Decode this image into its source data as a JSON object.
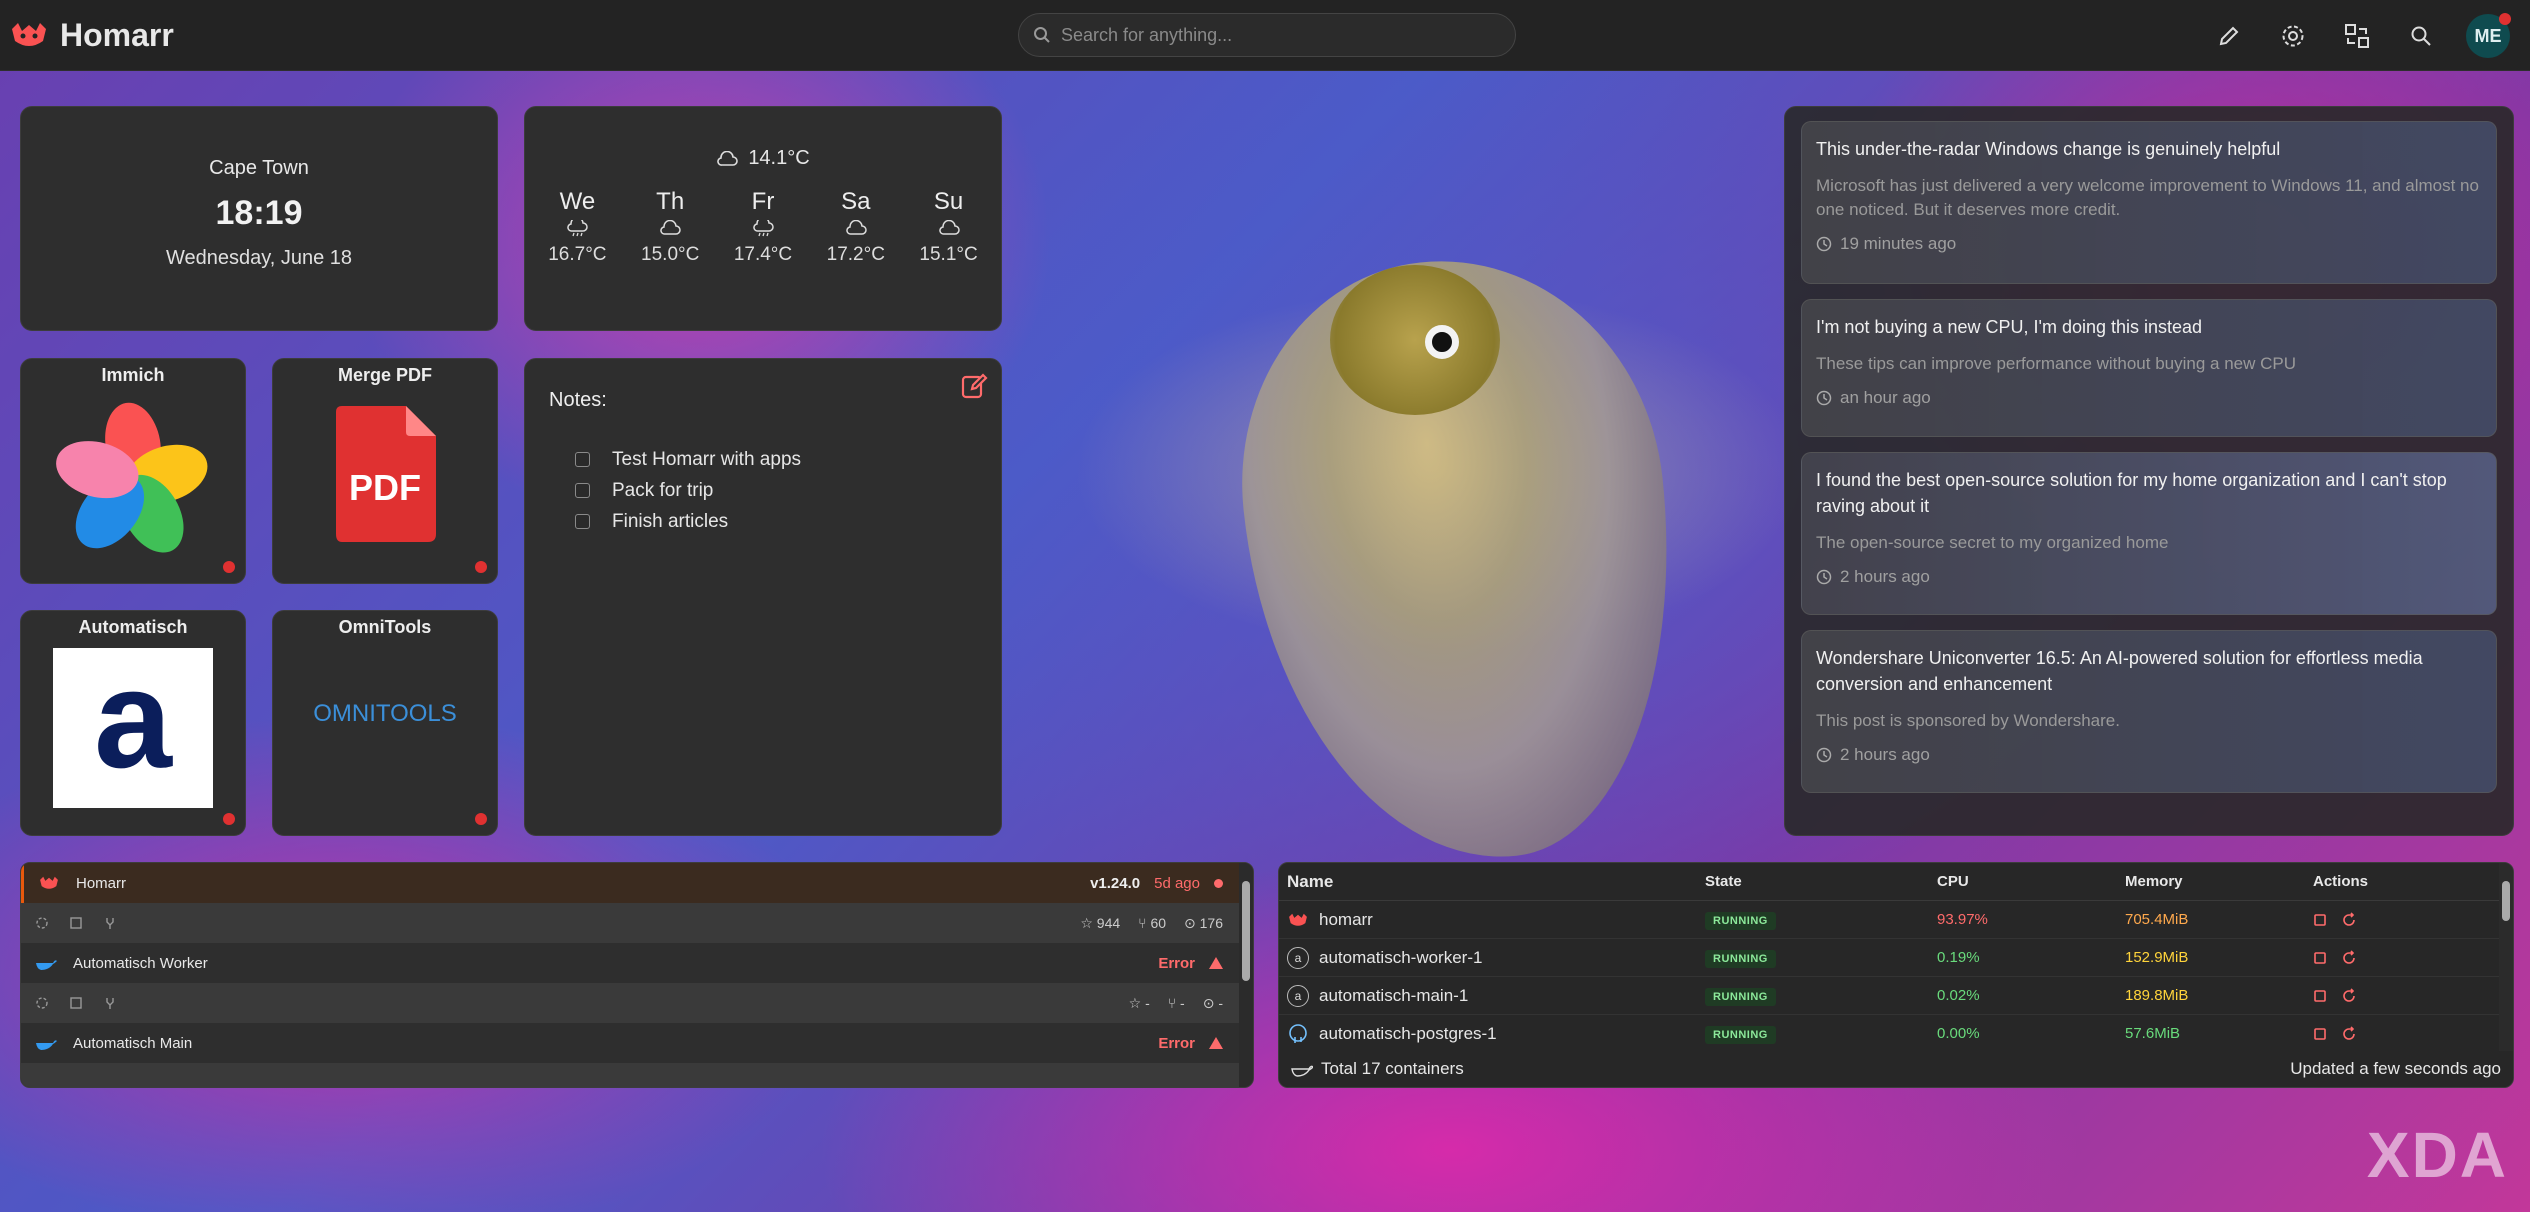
{
  "app": {
    "title": "Homarr"
  },
  "search": {
    "placeholder": "Search for anything..."
  },
  "user": {
    "initials": "ME"
  },
  "clock": {
    "city": "Cape Town",
    "time": "18:19",
    "date": "Wednesday, June 18"
  },
  "weather": {
    "current_temp": "14.1°C",
    "current_icon": "cloud-icon",
    "days": [
      {
        "day": "We",
        "temp": "16.7°C",
        "icon": "cloud-rain-icon"
      },
      {
        "day": "Th",
        "temp": "15.0°C",
        "icon": "cloud-icon"
      },
      {
        "day": "Fr",
        "temp": "17.4°C",
        "icon": "cloud-rain-icon"
      },
      {
        "day": "Sa",
        "temp": "17.2°C",
        "icon": "cloud-icon"
      },
      {
        "day": "Su",
        "temp": "15.1°C",
        "icon": "cloud-icon"
      }
    ]
  },
  "apps": [
    {
      "name": "Immich",
      "status": "offline",
      "icon": "immich-logo"
    },
    {
      "name": "Merge PDF",
      "status": "offline",
      "icon": "pdf-logo",
      "logo_text": "PDF"
    },
    {
      "name": "Automatisch",
      "status": "offline",
      "icon": "automatisch-logo",
      "logo_text": "a"
    },
    {
      "name": "OmniTools",
      "status": "offline",
      "icon": "omnitools-logo",
      "logo_text": "OMNITOOLS"
    }
  ],
  "notes": {
    "title": "Notes:",
    "items": [
      "Test Homarr with apps",
      "Pack for trip",
      "Finish articles"
    ]
  },
  "rss": [
    {
      "headline": "This under-the-radar Windows change is genuinely helpful",
      "summary": "Microsoft has just delivered a very welcome improvement to Windows 11, and almost no one noticed. But it deserves more credit.",
      "ago": "19 minutes ago"
    },
    {
      "headline": "I'm not buying a new CPU, I'm doing this instead",
      "summary": "These tips can improve performance without buying a new CPU",
      "ago": "an hour ago"
    },
    {
      "headline": "I found the best open-source solution for my home organization and I can't stop raving about it",
      "summary": "The open-source secret to my organized home",
      "ago": "2 hours ago"
    },
    {
      "headline": "Wondershare Uniconverter 16.5: An AI-powered solution for effortless media conversion and enhancement",
      "summary": "This post is sponsored by Wondershare.",
      "ago": "2 hours ago"
    }
  ],
  "releases": [
    {
      "name": "Homarr",
      "version": "v1.24.0",
      "ago": "5d ago",
      "stars": "944",
      "forks": "60",
      "issues": "176"
    },
    {
      "name": "Automatisch Worker",
      "status": "Error",
      "stars": "-",
      "forks": "-",
      "issues": "-"
    },
    {
      "name": "Automatisch Main",
      "status": "Error"
    }
  ],
  "containers": {
    "headers": {
      "name": "Name",
      "state": "State",
      "cpu": "CPU",
      "memory": "Memory",
      "actions": "Actions"
    },
    "rows": [
      {
        "name": "homarr",
        "state": "RUNNING",
        "cpu": "93.97%",
        "memory": "705.4MiB"
      },
      {
        "name": "automatisch-worker-1",
        "state": "RUNNING",
        "cpu": "0.19%",
        "memory": "152.9MiB"
      },
      {
        "name": "automatisch-main-1",
        "state": "RUNNING",
        "cpu": "0.02%",
        "memory": "189.8MiB"
      },
      {
        "name": "automatisch-postgres-1",
        "state": "RUNNING",
        "cpu": "0.00%",
        "memory": "57.6MiB"
      }
    ],
    "total": "Total 17 containers",
    "updated": "Updated a few seconds ago"
  },
  "watermark": "XDA",
  "colors": {
    "accent": "#e8590c",
    "error": "#ff6b6b",
    "running": "#8ce99a",
    "topbar": "#232323",
    "card": "#2e2e2e"
  }
}
